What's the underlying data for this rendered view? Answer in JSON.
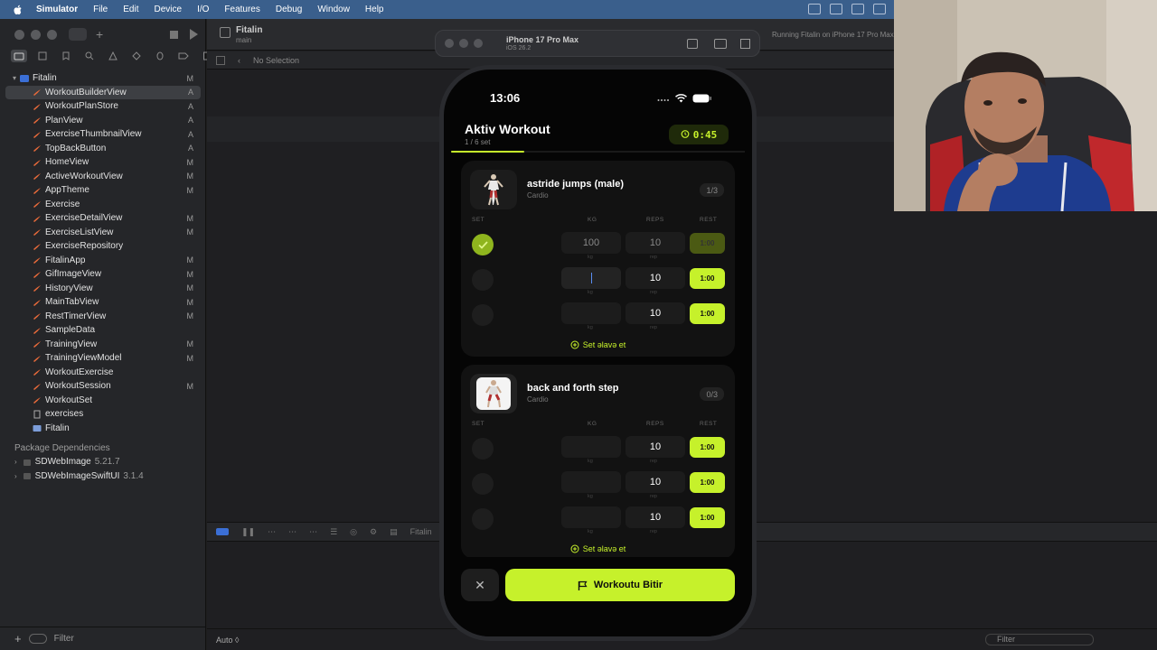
{
  "menubar": {
    "app": "Simulator",
    "items": [
      "File",
      "Edit",
      "Device",
      "I/O",
      "Features",
      "Debug",
      "Window",
      "Help"
    ]
  },
  "xcode": {
    "project": "Fitalin",
    "branch": "main",
    "scheme_label": "Fitalin",
    "device_name": "iPhone 17 Pro Max",
    "device_os": "iOS 26.2",
    "run_status": "Running Fitalin on iPhone 17 Pro Max",
    "breadcrumb": "No Selection",
    "debug_target": "Fitalin",
    "console_mode": "Auto ◊",
    "filter_placeholder": "Filter",
    "files": [
      {
        "name": "WorkoutBuilderView",
        "badge": "A",
        "selected": true
      },
      {
        "name": "WorkoutPlanStore",
        "badge": "A"
      },
      {
        "name": "PlanView",
        "badge": "A"
      },
      {
        "name": "ExerciseThumbnailView",
        "badge": "A"
      },
      {
        "name": "TopBackButton",
        "badge": "A"
      },
      {
        "name": "HomeView",
        "badge": "M"
      },
      {
        "name": "ActiveWorkoutView",
        "badge": "M"
      },
      {
        "name": "AppTheme",
        "badge": "M"
      },
      {
        "name": "Exercise",
        "badge": ""
      },
      {
        "name": "ExerciseDetailView",
        "badge": "M"
      },
      {
        "name": "ExerciseListView",
        "badge": "M"
      },
      {
        "name": "ExerciseRepository",
        "badge": ""
      },
      {
        "name": "FitalinApp",
        "badge": "M"
      },
      {
        "name": "GifImageView",
        "badge": "M"
      },
      {
        "name": "HistoryView",
        "badge": "M"
      },
      {
        "name": "MainTabView",
        "badge": "M"
      },
      {
        "name": "RestTimerView",
        "badge": "M"
      },
      {
        "name": "SampleData",
        "badge": ""
      },
      {
        "name": "TrainingView",
        "badge": "M"
      },
      {
        "name": "TrainingViewModel",
        "badge": "M"
      },
      {
        "name": "WorkoutExercise",
        "badge": ""
      },
      {
        "name": "WorkoutSession",
        "badge": "M"
      },
      {
        "name": "WorkoutSet",
        "badge": ""
      },
      {
        "name": "exercises",
        "badge": ""
      },
      {
        "name": "Fitalin",
        "badge": ""
      }
    ],
    "root_badge": "M",
    "packages_header": "Package Dependencies",
    "packages": [
      {
        "name": "SDWebImage",
        "version": "5.21.7"
      },
      {
        "name": "SDWebImageSwiftUI",
        "version": "3.1.4"
      }
    ]
  },
  "app": {
    "time": "13:06",
    "title": "Aktiv Workout",
    "subtitle": "1 / 6 set",
    "progress": 0.1667,
    "timer": "0:45",
    "columns": {
      "set": "SET",
      "kg": "KG",
      "reps": "REPS",
      "rest": "REST"
    },
    "unit_kg": "kg",
    "unit_rep": "rep",
    "add_set": "Set əlavə et",
    "finish": "Workoutu Bitir",
    "accent": "#c6f12b",
    "exercises": [
      {
        "name": "astride jumps (male)",
        "category": "Cardio",
        "count": "1/3",
        "sets": [
          {
            "done": true,
            "kg": "100",
            "reps": "10",
            "rest": "1:00"
          },
          {
            "done": false,
            "kg": "",
            "reps": "10",
            "rest": "1:00",
            "editing": true
          },
          {
            "done": false,
            "kg": "",
            "reps": "10",
            "rest": "1:00"
          }
        ]
      },
      {
        "name": "back and forth step",
        "category": "Cardio",
        "count": "0/3",
        "sets": [
          {
            "done": false,
            "kg": "",
            "reps": "10",
            "rest": "1:00"
          },
          {
            "done": false,
            "kg": "",
            "reps": "10",
            "rest": "1:00"
          },
          {
            "done": false,
            "kg": "",
            "reps": "10",
            "rest": "1:00"
          }
        ]
      }
    ]
  }
}
